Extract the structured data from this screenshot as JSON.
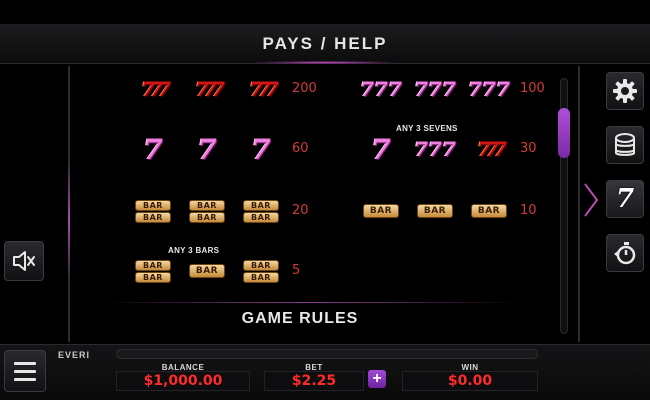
{
  "header": {
    "title": "PAYS / HELP"
  },
  "paytable": {
    "left": [
      {
        "symbols": [
          "triple-seven-red",
          "triple-seven-red",
          "triple-seven-red"
        ],
        "pay": "200"
      },
      {
        "symbols": [
          "seven-pink",
          "seven-pink",
          "seven-pink"
        ],
        "pay": "60"
      },
      {
        "symbols": [
          "double-bar",
          "double-bar",
          "double-bar"
        ],
        "pay": "20"
      },
      {
        "note": "ANY 3 BARS",
        "symbols": [
          "double-bar",
          "single-bar",
          "double-bar"
        ],
        "pay": "5"
      }
    ],
    "right": [
      {
        "symbols": [
          "triple-seven-pink",
          "triple-seven-pink",
          "triple-seven-pink"
        ],
        "pay": "100"
      },
      {
        "note": "ANY 3 SEVENS",
        "symbols": [
          "seven-pink",
          "triple-seven-pink",
          "triple-seven-red"
        ],
        "pay": "30"
      },
      {
        "symbols": [
          "single-bar",
          "single-bar",
          "single-bar"
        ],
        "pay": "10"
      }
    ],
    "bar_text": "BAR",
    "seven_text": "7",
    "triple_seven_text": "777"
  },
  "game_rules": {
    "title": "GAME RULES"
  },
  "side_buttons": [
    {
      "icon": "gear-icon"
    },
    {
      "icon": "coins-icon"
    },
    {
      "icon": "seven-icon",
      "label": "7"
    },
    {
      "icon": "autoplay-icon"
    }
  ],
  "sound": {
    "icon": "speaker-mute-icon"
  },
  "bottom": {
    "brand": "EVERI",
    "balance_label": "BALANCE",
    "balance_value": "$1,000.00",
    "bet_label": "BET",
    "bet_value": "$2.25",
    "plus_label": "+",
    "win_label": "WIN",
    "win_value": "$0.00"
  },
  "colors": {
    "accent": "#a44ad8",
    "pay_red": "#d63a3a",
    "value_red": "#ff2a2a"
  }
}
